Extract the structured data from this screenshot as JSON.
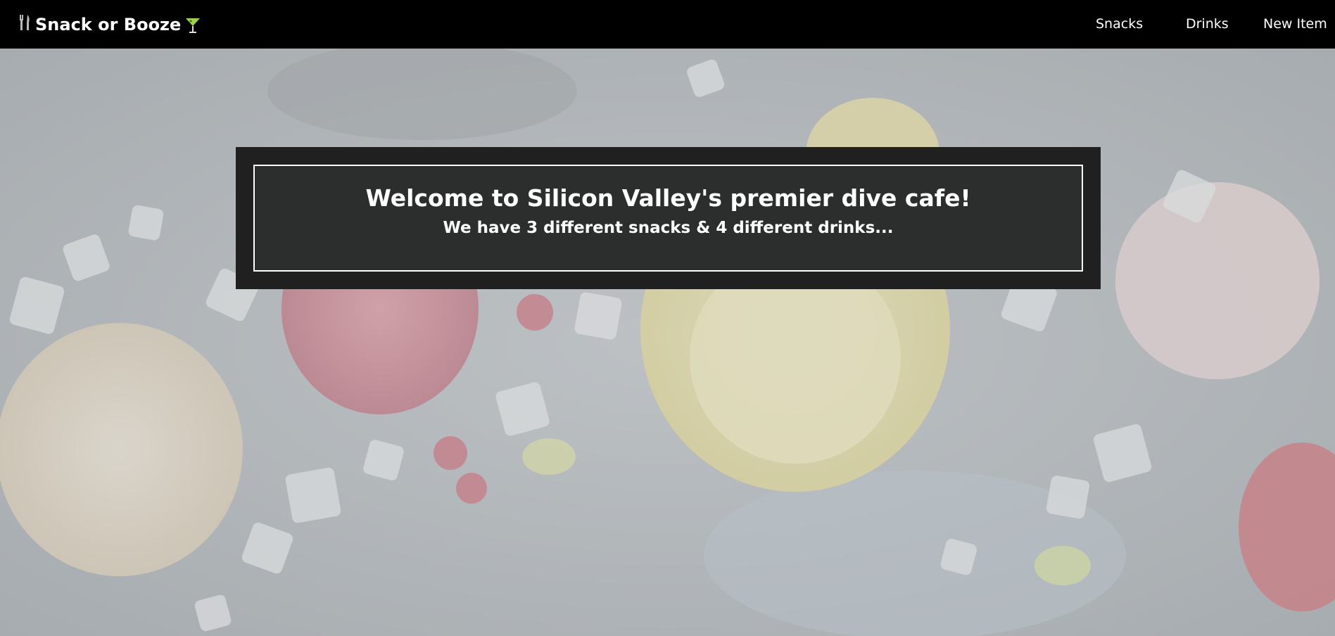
{
  "navbar": {
    "brand": "Snack or Booze",
    "brand_left_icon": "fork-knife-icon",
    "brand_right_icon": "cocktail-glass-icon",
    "links": [
      {
        "label": "Snacks"
      },
      {
        "label": "Drinks"
      },
      {
        "label": "New Item"
      }
    ]
  },
  "welcome": {
    "title": "Welcome to Silicon Valley's premier dive cafe!",
    "subtitle": "We have 3 different snacks & 4 different drinks..."
  },
  "colors": {
    "navbar_bg": "#000000",
    "card_bg": "#202020",
    "card_inner_bg": "#2c2d2d",
    "text": "#ffffff"
  }
}
